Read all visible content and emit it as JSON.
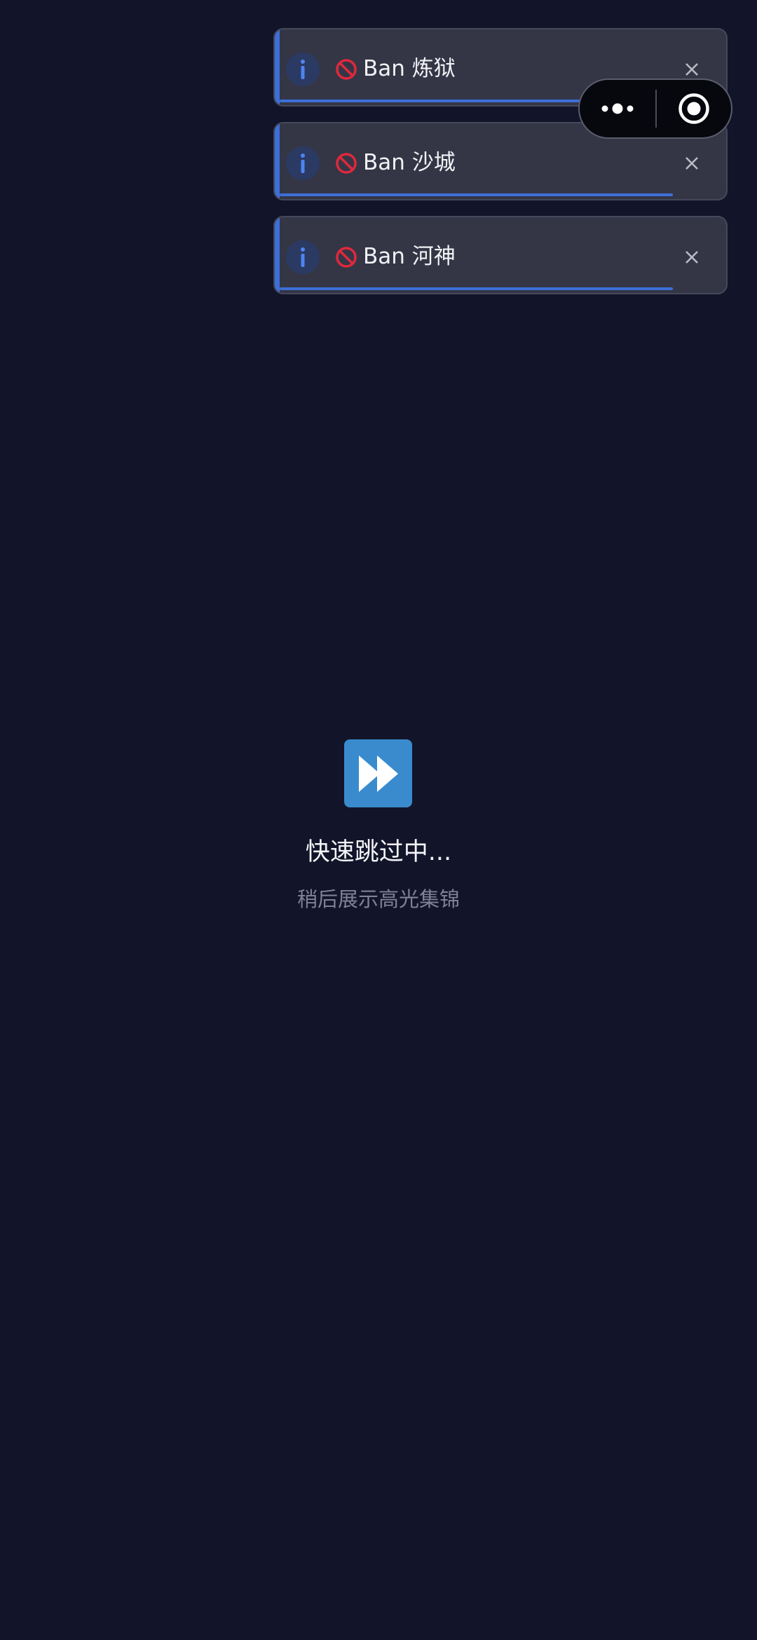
{
  "notifications": [
    {
      "message": "Ban 炼狱",
      "progress_percent": 88
    },
    {
      "message": "Ban 沙城",
      "progress_percent": 88
    },
    {
      "message": "Ban 河神",
      "progress_percent": 88
    }
  ],
  "icons": {
    "info": "info-icon",
    "ban": "ban-icon",
    "close": "close-icon",
    "more": "more-dots-icon",
    "exit": "target-circle-icon",
    "skip": "fast-forward-icon"
  },
  "colors": {
    "background": "#12152a",
    "accent": "#3d6fd8",
    "ban": "#e0283c",
    "skip_icon_bg": "#3a8bce"
  },
  "status": {
    "title": "快速跳过中...",
    "subtitle": "稍后展示高光集锦"
  }
}
